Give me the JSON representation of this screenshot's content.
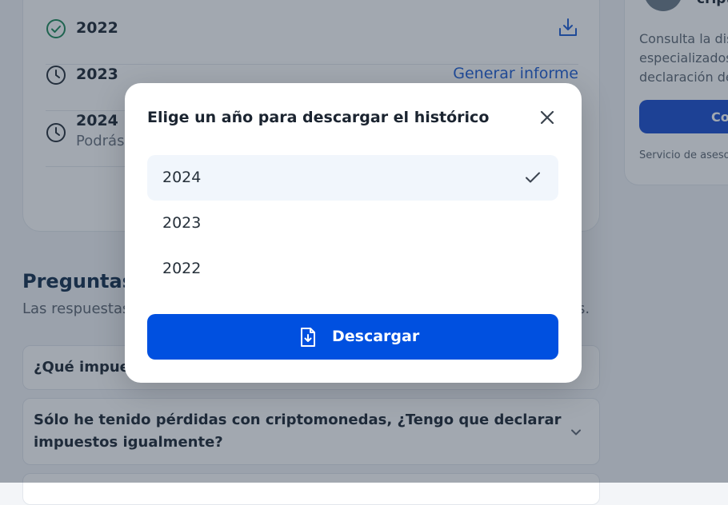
{
  "background": {
    "years": [
      {
        "year": "2022",
        "status": "ready",
        "action": "download"
      },
      {
        "year": "2023",
        "status": "pending",
        "action_label": "Generar informe"
      },
      {
        "year": "2024",
        "status": "pending",
        "subtitle": "Podrás"
      }
    ],
    "side_card": {
      "title": "cript",
      "text": "Consulta la dis\nespecializados\ndeclaración de",
      "button_label": "Co",
      "footer": "Servicio de aseso"
    },
    "faq": {
      "title": "Preguntas f",
      "subtitle": "Las respuestas",
      "subtitle_end": "s.",
      "items": [
        {
          "question": "¿Qué impues"
        },
        {
          "question_line1": "Sólo he tenido pérdidas con criptomonedas, ¿Tengo que declarar",
          "question_line2": "impuestos igualmente?"
        }
      ]
    }
  },
  "modal": {
    "title": "Elige un año para descargar el histórico",
    "options": [
      {
        "label": "2024",
        "selected": true
      },
      {
        "label": "2023",
        "selected": false
      },
      {
        "label": "2022",
        "selected": false
      }
    ],
    "download_label": "Descargar"
  },
  "colors": {
    "primary": "#0050e0",
    "link": "#1f5fd6",
    "success": "#1e8a5a",
    "overlay": "rgba(34,48,66,0.42)",
    "selected_bg": "#f1f6fc"
  }
}
